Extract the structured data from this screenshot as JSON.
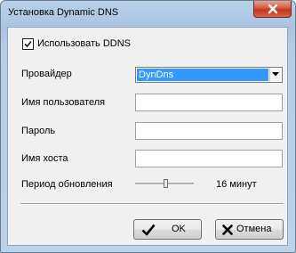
{
  "window": {
    "title": "Установка Dynamic DNS"
  },
  "ddns": {
    "use_label": "Использовать DDNS",
    "use_checked": true
  },
  "fields": {
    "provider_label": "Провайдер",
    "provider_value": "DynDns",
    "username_label": "Имя пользователя",
    "username_value": "",
    "password_label": "Пароль",
    "password_value": "",
    "hostname_label": "Имя хоста",
    "hostname_value": ""
  },
  "update_period": {
    "label": "Период обновления",
    "value_text": "16 минут",
    "slider_fraction": 0.52
  },
  "buttons": {
    "ok_label": "OK",
    "cancel_label": "Отмена"
  },
  "icons": {
    "close": "close-x-icon",
    "checkmark": "checkmark-icon",
    "dropdown": "chevron-down-icon",
    "ok": "checkmark-icon",
    "cancel": "cross-icon"
  }
}
